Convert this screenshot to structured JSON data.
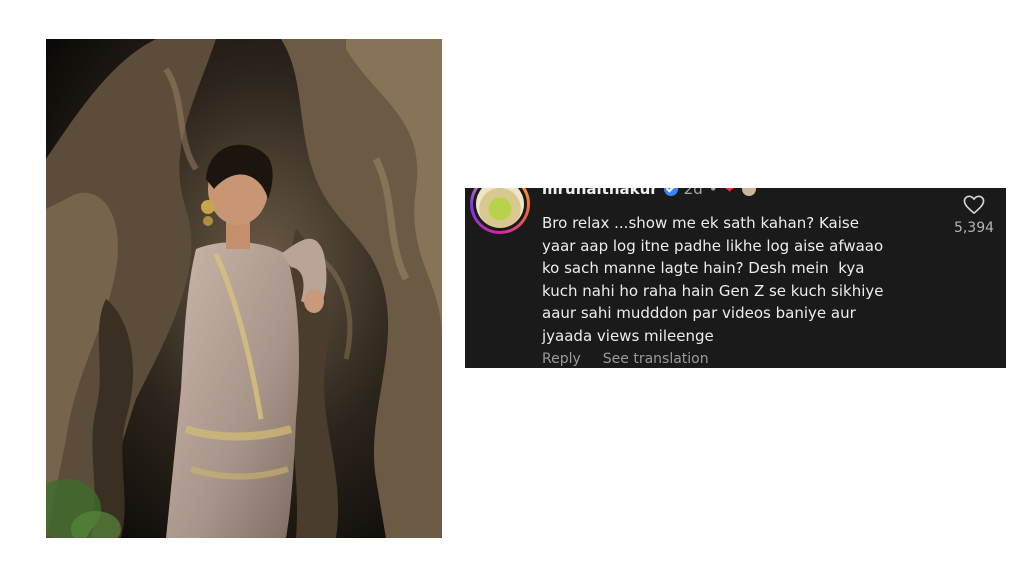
{
  "photo": {
    "alt": "Woman in embroidered outfit posing against a tree trunk"
  },
  "comment": {
    "username": "mrunalthakur",
    "time_ago": "2d",
    "separator": "•",
    "text": "Bro relax ...show me ek sath kahan? Kaise\nyaar aap log itne padhe likhe log aise afwaao\nko sach manne lagte hain? Desh mein  kya\nkuch nahi ho raha hain Gen Z se kuch sikhiye\naaur sahi mudddon par videos baniye aur\njyaada views mileenge",
    "like_count": "5,394",
    "reply_label": "Reply",
    "translate_label": "See translation",
    "icons": [
      "verified-badge-icon",
      "heart-icon",
      "like-icon"
    ]
  },
  "colors": {
    "card_bg": "#1a1a1a",
    "text": "#ececec",
    "muted": "#9a9a9a",
    "heart": "#ff3040",
    "verified": "#3b82f6"
  }
}
